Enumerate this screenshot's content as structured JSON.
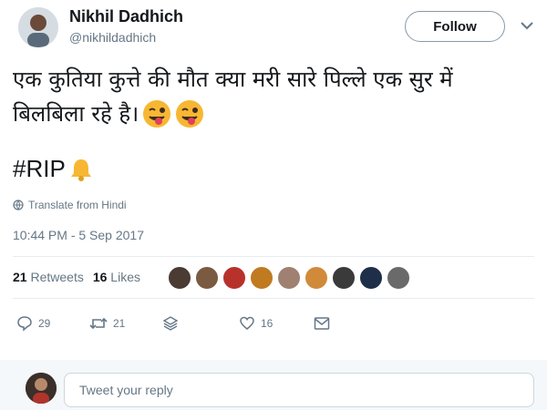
{
  "author": {
    "display_name": "Nikhil Dadhich",
    "handle": "@nikhildadhich",
    "follow_label": "Follow"
  },
  "tweet": {
    "line1": "एक कुतिया कुत्ते की मौत क्या मरी सारे पिल्ले एक सुर में",
    "line2": "बिलबिला रहे है।",
    "emojis": [
      "winking-face-with-tongue",
      "winking-face-with-tongue"
    ],
    "hashtag": "#RIP",
    "hashtag_emoji": "bell",
    "translate_label": "Translate from Hindi",
    "timestamp": "10:44 PM - 5 Sep 2017"
  },
  "stats": {
    "retweets_count": "21",
    "retweets_label": "Retweets",
    "likes_count": "16",
    "likes_label": "Likes",
    "liker_avatar_count": 9
  },
  "actions": {
    "reply_count": "29",
    "retweet_count": "21",
    "like_count": "16"
  },
  "reply": {
    "placeholder": "Tweet your reply"
  },
  "colors": {
    "text": "#14171a",
    "muted": "#657786",
    "divider": "#e6ecf0",
    "reply_bg": "#f5f8fa",
    "emoji_yellow": "#f7b733",
    "emoji_tongue": "#e0405a"
  }
}
